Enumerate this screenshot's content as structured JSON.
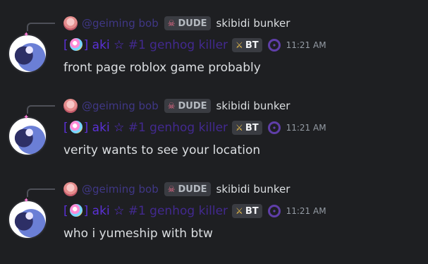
{
  "messages": [
    {
      "reply": {
        "author": "@geiming bob",
        "tag": "DUDE",
        "text": "skibidi bunker"
      },
      "author": {
        "prefix": "[",
        "suffix": "] aki ☆ ",
        "faded": "#1 genhog killer",
        "tag": "BT"
      },
      "time": "11:21 AM",
      "text": "front page roblox game probably"
    },
    {
      "reply": {
        "author": "@geiming bob",
        "tag": "DUDE",
        "text": "skibidi bunker"
      },
      "author": {
        "prefix": "[",
        "suffix": "] aki ☆ ",
        "faded": "#1 genhog killer",
        "tag": "BT"
      },
      "time": "11:21 AM",
      "text": "verity wants to see your location"
    },
    {
      "reply": {
        "author": "@geiming bob",
        "tag": "DUDE",
        "text": "skibidi bunker"
      },
      "author": {
        "prefix": "[",
        "suffix": "] aki ☆ ",
        "faded": "#1 genhog killer",
        "tag": "BT"
      },
      "time": "11:21 AM",
      "text": "who i yumeship with btw"
    }
  ],
  "colors": {
    "background": "#1e1f22",
    "username": "#5b31d8",
    "reply_username": "#5b4bd6",
    "timestamp": "#949ba4",
    "text": "#dbdee1"
  },
  "icons": {
    "reply_avatar": "pink-character-avatar-icon",
    "avatar": "anime-character-avatar-icon",
    "palette": "palette-emoji-icon",
    "skull": "skull-icon",
    "sword": "sword-icon",
    "wheel": "wheel-icon"
  }
}
